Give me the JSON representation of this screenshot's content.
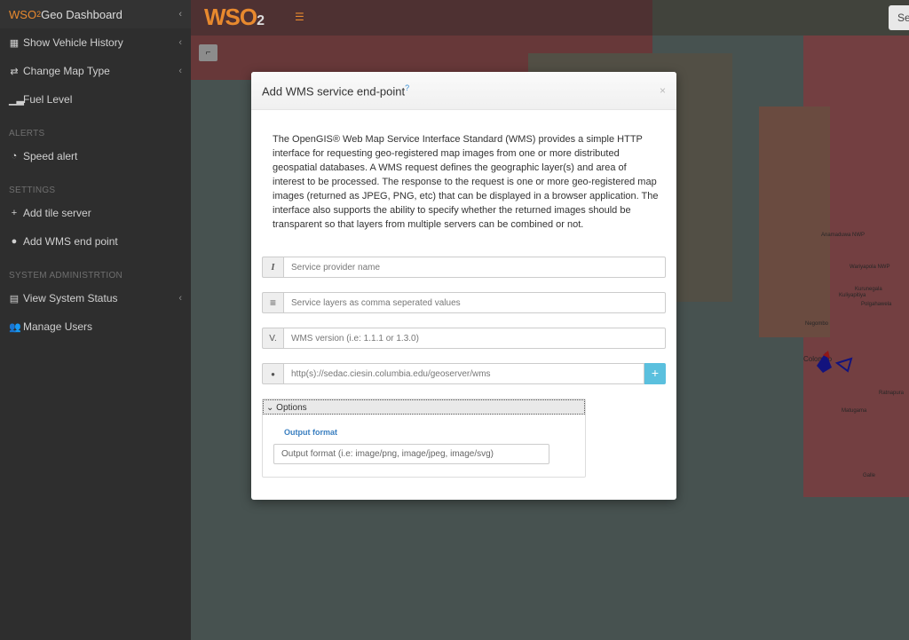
{
  "sidebar": {
    "brand": {
      "wso": "WSO",
      "sub": "2",
      "title": " Geo Dashboard"
    },
    "items": [
      {
        "label": "Show Vehicle History",
        "icon": "calendar-icon"
      },
      {
        "label": "Change Map Type",
        "icon": "exchange-icon"
      },
      {
        "label": "Fuel Level",
        "icon": "signal-icon"
      }
    ],
    "alerts_heading": "ALERTS",
    "alerts": [
      {
        "label": "Speed alert",
        "icon": "dashboard-icon"
      }
    ],
    "settings_heading": "SETTINGS",
    "settings": [
      {
        "label": "Add tile server",
        "icon": "plus-icon"
      },
      {
        "label": "Add WMS end point",
        "icon": "globe-icon"
      }
    ],
    "admin_heading": "SYSTEM ADMINISTRTION",
    "admin": [
      {
        "label": "View System Status",
        "icon": "chart-icon"
      },
      {
        "label": "Manage Users",
        "icon": "users-icon"
      }
    ]
  },
  "topbar": {
    "logo_text": "WSO",
    "logo_sub": "2",
    "search_label": "Se"
  },
  "map": {
    "places": [
      "Anamaduwa NWP",
      "Wariyapola NWP",
      "Kurunegala",
      "Kuliyapitiya",
      "Polgahawela",
      "Negombo",
      "Colombo",
      "Ratnapura",
      "Matugama",
      "Galle"
    ]
  },
  "modal": {
    "title": "Add WMS service end-point",
    "title_sup": "?",
    "close": "×",
    "description": "The OpenGIS® Web Map Service Interface Standard (WMS) provides a simple HTTP interface for requesting geo-registered map images from one or more distributed geospatial databases. A WMS request defines the geographic layer(s) and area of interest to be processed. The response to the request is one or more geo-registered map images (returned as JPEG, PNG, etc) that can be displayed in a browser application. The interface also supports the ability to specify whether the returned images should be transparent so that layers from multiple servers can be combined or not.",
    "fields": {
      "provider": {
        "addon": "I",
        "placeholder": "Service provider name"
      },
      "layers": {
        "addon": "≡",
        "placeholder": "Service layers as comma seperated values"
      },
      "version": {
        "addon": "V.",
        "placeholder": "WMS version (i.e: 1.1.1 or 1.3.0)"
      },
      "url": {
        "addon": "●",
        "placeholder": "http(s)://sedac.ciesin.columbia.edu/geoserver/wms",
        "add_label": "+"
      }
    },
    "options": {
      "toggle_label": "Options",
      "output_format_label": "Output format",
      "output_format_placeholder": "Output format (i.e: image/png, image/jpeg, image/svg)"
    }
  },
  "colors": {
    "sidebar_bg": "#2e2e2e",
    "accent": "#e8892e",
    "link_blue": "#3a7fc0",
    "info_button": "#5bc0de"
  }
}
